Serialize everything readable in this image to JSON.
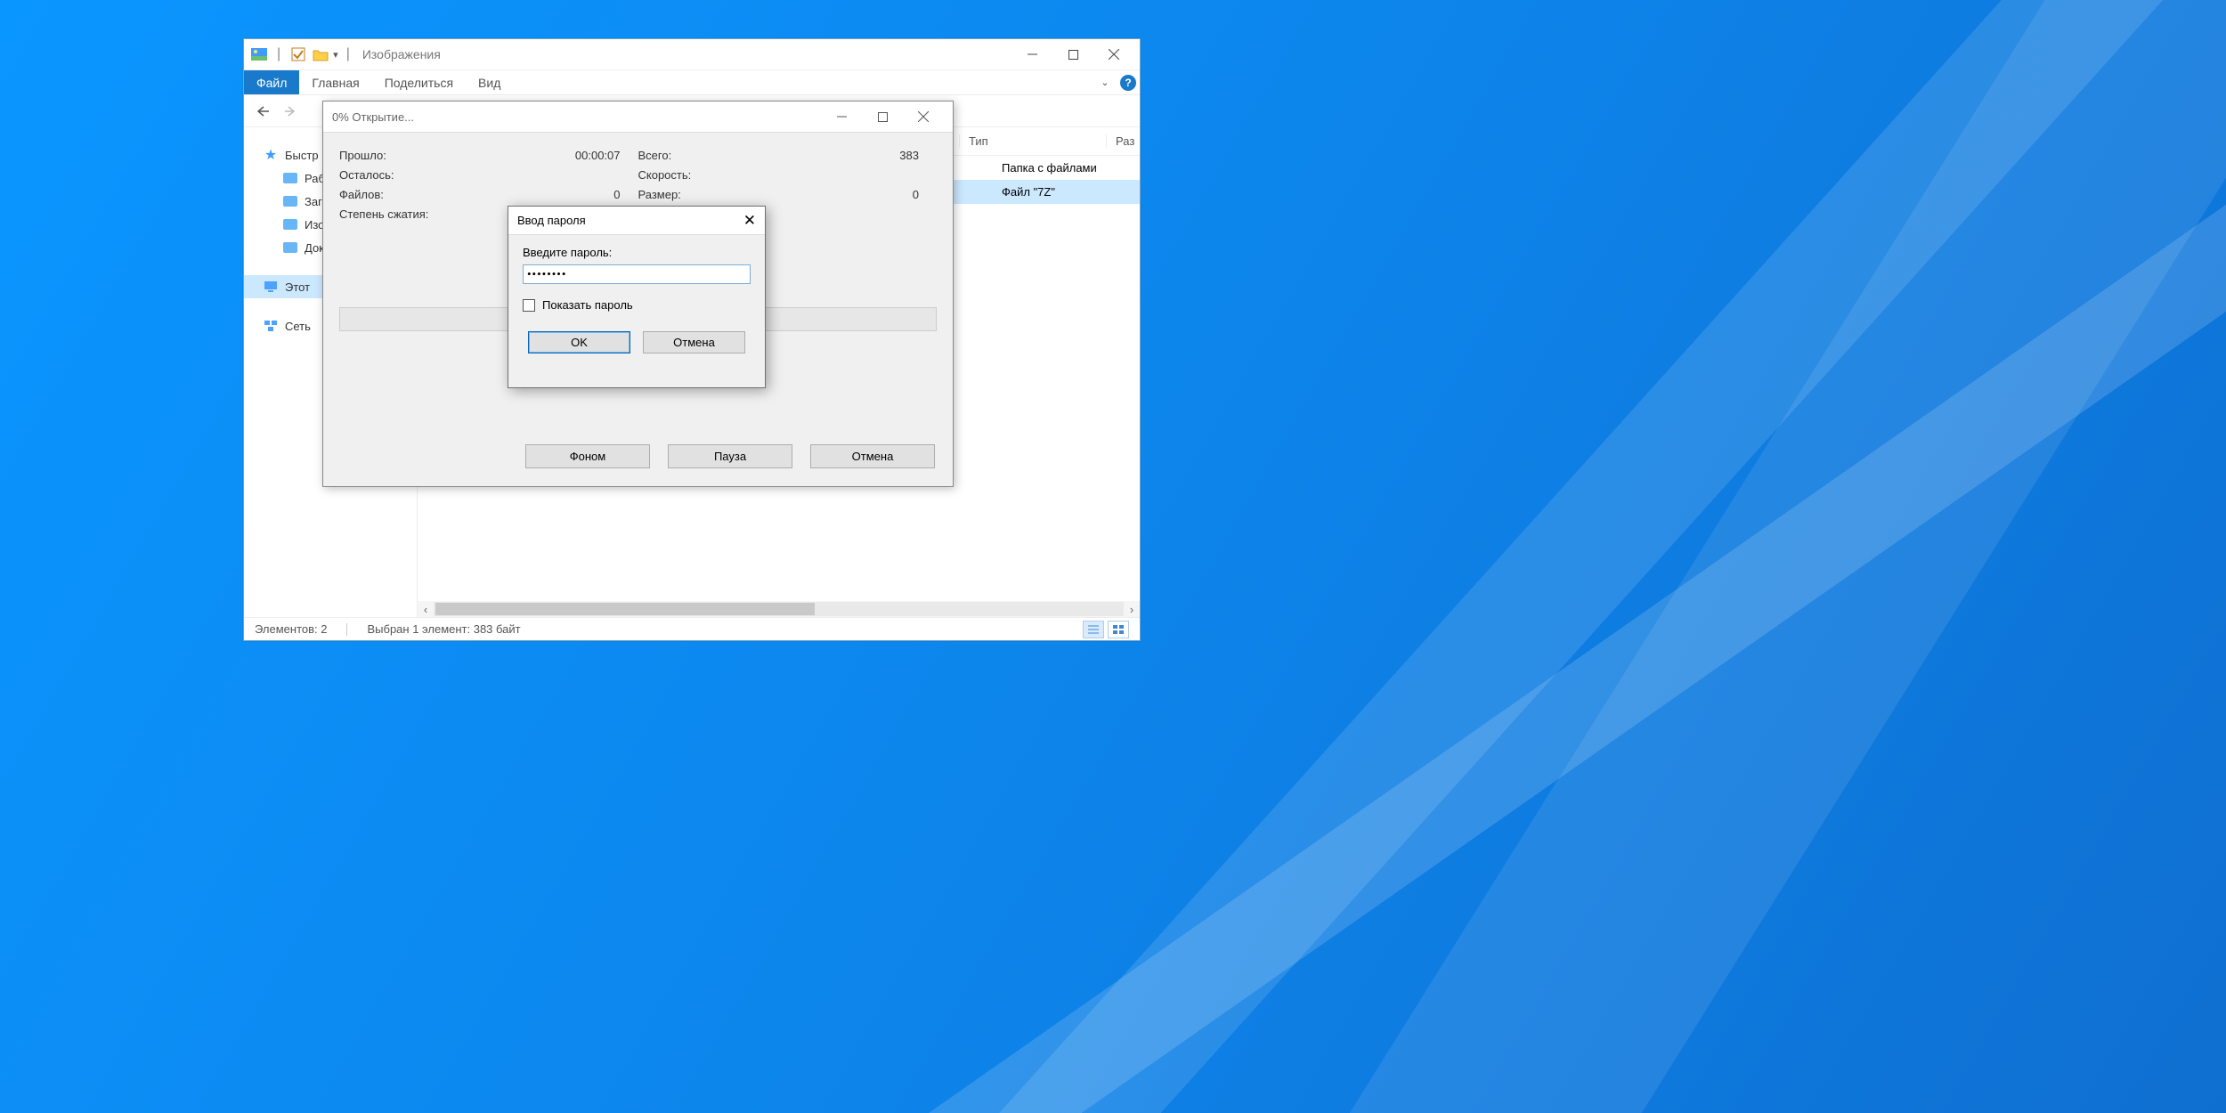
{
  "explorer": {
    "title": "Изображения",
    "tabs": {
      "file": "Файл",
      "home": "Главная",
      "share": "Поделиться",
      "view": "Вид"
    },
    "sidebar": {
      "quick": "Быстр",
      "items": [
        "Раб",
        "Заг",
        "Изо",
        "Док"
      ],
      "this_pc": "Этот",
      "network": "Сеть"
    },
    "columns": {
      "type": "Тип",
      "size": "Раз"
    },
    "rows": [
      {
        "type": "Папка с файлами"
      },
      {
        "type": "Файл \"7Z\""
      }
    ],
    "status": {
      "count": "Элементов: 2",
      "selected": "Выбран 1 элемент: 383 байт"
    }
  },
  "progress": {
    "title": "0% Открытие...",
    "left": {
      "elapsed_l": "Прошло:",
      "elapsed_v": "00:00:07",
      "remain_l": "Осталось:",
      "files_l": "Файлов:",
      "files_v": "0",
      "ratio_l": "Степень сжатия:"
    },
    "right": {
      "total_l": "Всего:",
      "total_v": "383",
      "speed_l": "Скорость:",
      "size_l": "Размер:",
      "size_v": "0"
    },
    "buttons": {
      "bg": "Фоном",
      "pause": "Пауза",
      "cancel": "Отмена"
    }
  },
  "password": {
    "title": "Ввод пароля",
    "label": "Введите пароль:",
    "value": "********",
    "show": "Показать пароль",
    "ok": "OK",
    "cancel": "Отмена"
  }
}
